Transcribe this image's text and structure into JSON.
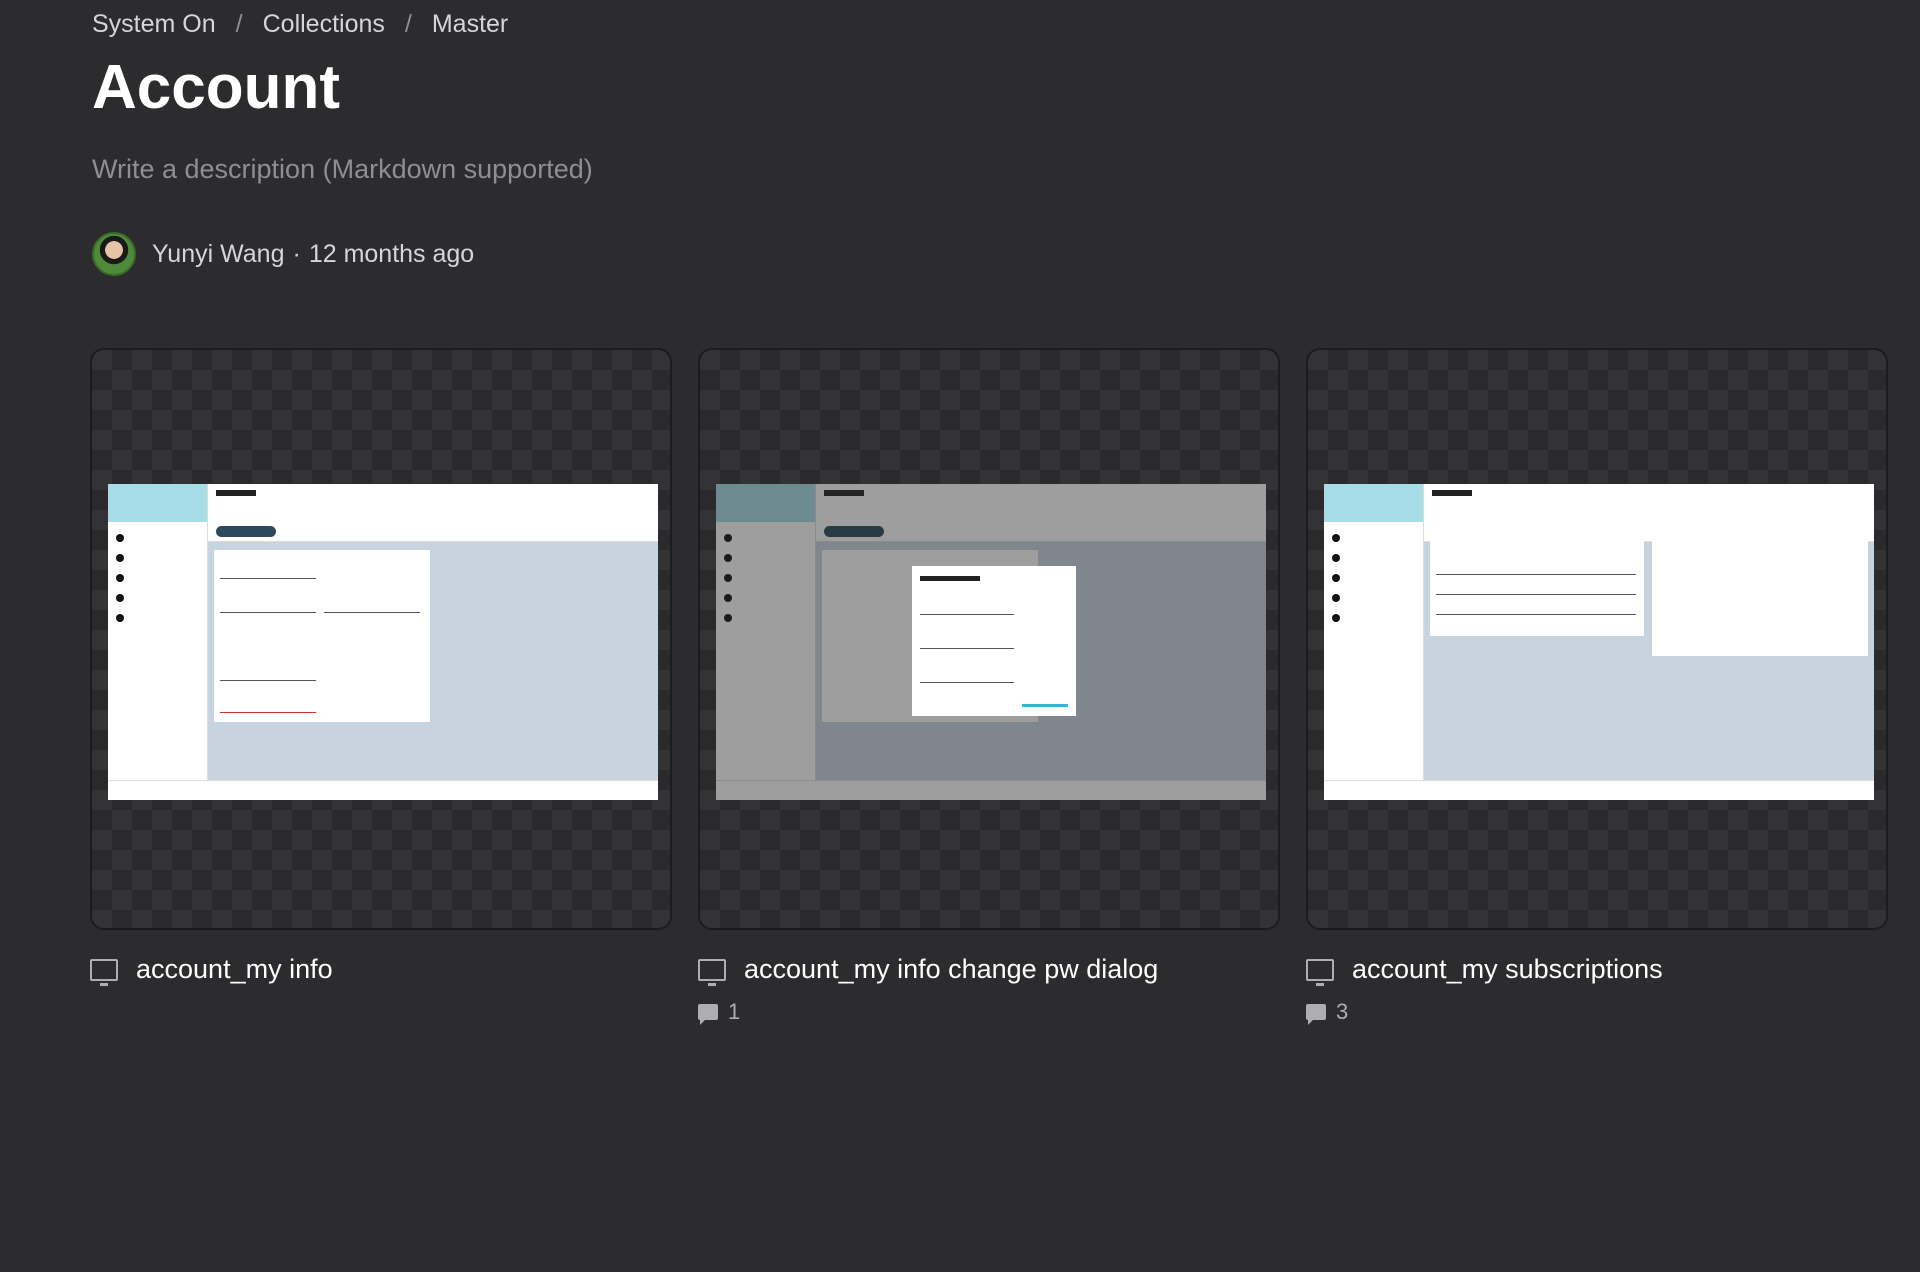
{
  "breadcrumb": [
    "System On",
    "Collections",
    "Master"
  ],
  "title": "Account",
  "description_placeholder": "Write a description (Markdown supported)",
  "author": {
    "name": "Yunyi Wang",
    "time": "12 months ago"
  },
  "cards": [
    {
      "title": "account_my info",
      "comments": ""
    },
    {
      "title": "account_my info change pw dialog",
      "comments": "1"
    },
    {
      "title": "account_my subscriptions",
      "comments": "3"
    }
  ]
}
